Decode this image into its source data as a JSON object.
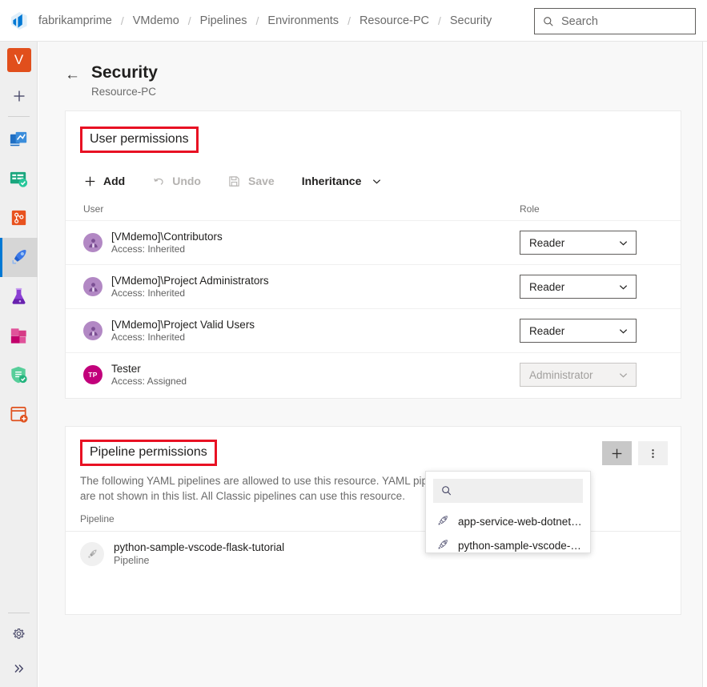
{
  "topbar": {
    "logo_icon": "azure-devops-logo",
    "breadcrumb": [
      "fabrikamprime",
      "VMdemo",
      "Pipelines",
      "Environments",
      "Resource-PC",
      "Security"
    ],
    "separator": "/",
    "search": {
      "placeholder": "Search",
      "value": "",
      "icon": "search-icon"
    }
  },
  "rail": {
    "org_initial": "V",
    "add_label": "+",
    "items": [
      {
        "name": "overview",
        "icon": "overview-icon"
      },
      {
        "name": "boards",
        "icon": "boards-icon"
      },
      {
        "name": "repos",
        "icon": "repos-icon"
      },
      {
        "name": "pipelines",
        "icon": "pipelines-rocket-icon",
        "selected": true
      },
      {
        "name": "test-plans",
        "icon": "test-plans-flask-icon"
      },
      {
        "name": "artifacts",
        "icon": "artifacts-icon"
      },
      {
        "name": "advanced-security",
        "icon": "shield-icon"
      },
      {
        "name": "billing",
        "icon": "billing-icon"
      }
    ],
    "bottom": [
      {
        "name": "settings",
        "icon": "gear-icon"
      },
      {
        "name": "expand",
        "icon": "double-chevron-right-icon"
      }
    ]
  },
  "page": {
    "back_icon": "back-arrow-icon",
    "title": "Security",
    "subtitle": "Resource-PC"
  },
  "user_permissions": {
    "title": "User permissions",
    "toolbar": [
      {
        "label": "Add",
        "icon": "plus-icon",
        "disabled": false
      },
      {
        "label": "Undo",
        "icon": "undo-icon",
        "disabled": true
      },
      {
        "label": "Save",
        "icon": "save-disk-icon",
        "disabled": true
      },
      {
        "label": "Inheritance",
        "icon": "chevron-down-icon",
        "disabled": false
      }
    ],
    "columns": {
      "user": "User",
      "role": "Role"
    },
    "rows": [
      {
        "name": "[VMdemo]\\Contributors",
        "access": "Access: Inherited",
        "role": "Reader",
        "avatar_type": "group",
        "role_disabled": false
      },
      {
        "name": "[VMdemo]\\Project Administrators",
        "access": "Access: Inherited",
        "role": "Reader",
        "avatar_type": "group",
        "role_disabled": false
      },
      {
        "name": "[VMdemo]\\Project Valid Users",
        "access": "Access: Inherited",
        "role": "Reader",
        "avatar_type": "group",
        "role_disabled": false
      },
      {
        "name": "Tester",
        "access": "Access: Assigned",
        "role": "Administrator",
        "avatar_type": "initials",
        "initials": "TP",
        "role_disabled": true
      }
    ]
  },
  "pipeline_permissions": {
    "title": "Pipeline permissions",
    "description_line1": "The following YAML pipelines are allowed to use this resource. YAML pipelines from other projects",
    "description_line2": "are not shown in this list. All Classic pipelines can use this resource.",
    "add_button": {
      "label": "+",
      "icon": "plus-icon",
      "state": "pressed"
    },
    "more_button": {
      "label": "⋮",
      "icon": "more-vertical-icon"
    },
    "column_header": "Pipeline",
    "rows": [
      {
        "name": "python-sample-vscode-flask-tutorial",
        "subtitle": "Pipeline",
        "icon": "rocket-icon"
      }
    ]
  },
  "pipeline_picker": {
    "search": {
      "placeholder": "",
      "value": "",
      "icon": "search-icon"
    },
    "options": [
      {
        "label": "app-service-web-dotnet…",
        "icon": "rocket-icon"
      },
      {
        "label": "python-sample-vscode-…",
        "icon": "rocket-icon"
      }
    ]
  },
  "colors": {
    "accent": "#0078d4",
    "annotation": "#e81123",
    "org_tile": "#e14f1c",
    "group_avatar": "#b288c4",
    "user_avatar": "#c2007b"
  }
}
